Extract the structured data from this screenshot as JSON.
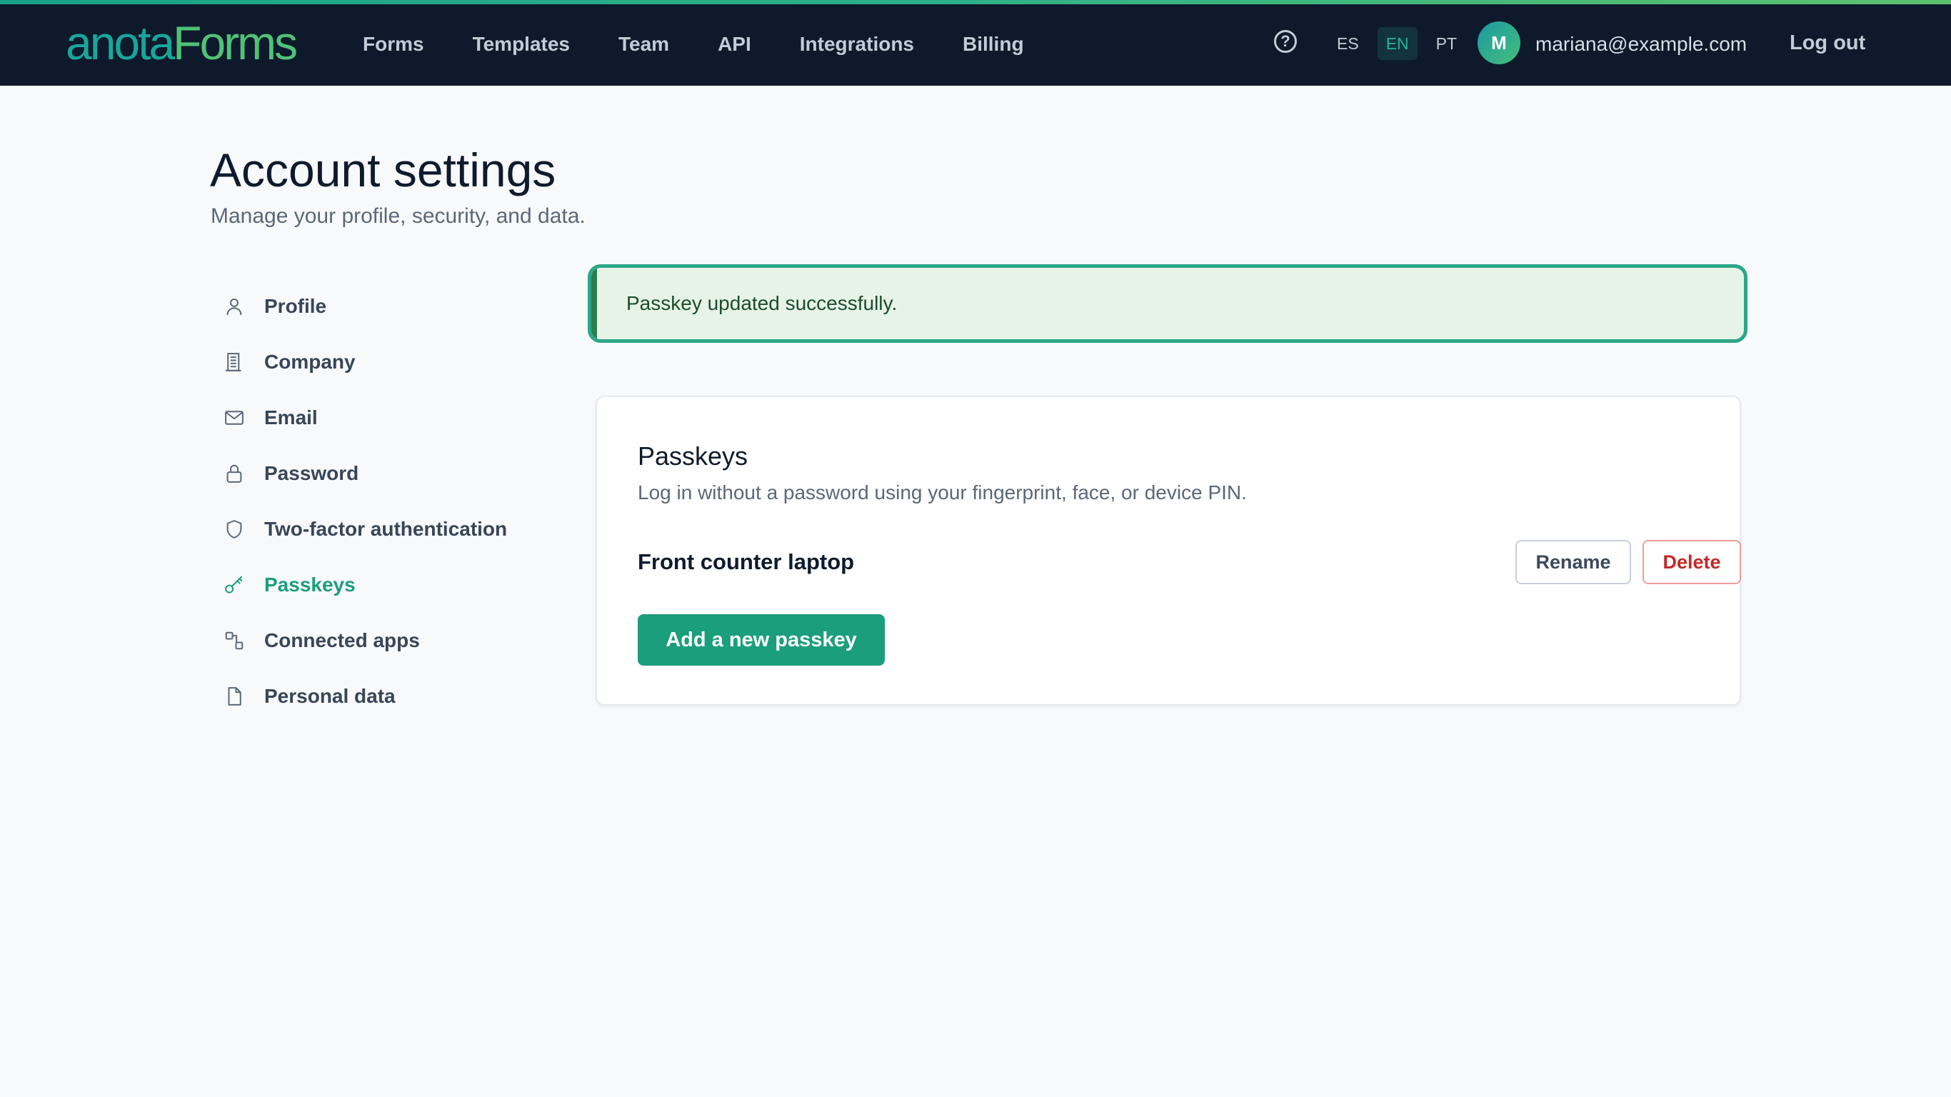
{
  "app": {
    "logo_part1": "anota",
    "logo_part2": "Forms",
    "brand_colors": {
      "teal": "#17a79a",
      "green": "#4fc277",
      "accent": "#1b9e7c"
    }
  },
  "topnav": {
    "items": [
      {
        "label": "Forms"
      },
      {
        "label": "Templates"
      },
      {
        "label": "Team"
      },
      {
        "label": "API"
      },
      {
        "label": "Integrations"
      },
      {
        "label": "Billing"
      }
    ],
    "help_icon": "question-circle-icon",
    "help_glyph": "?",
    "languages": [
      {
        "code": "ES",
        "active": false
      },
      {
        "code": "EN",
        "active": true
      },
      {
        "code": "PT",
        "active": false
      }
    ],
    "user": {
      "initial": "M",
      "email": "mariana@example.com"
    },
    "logout_label": "Log out"
  },
  "page": {
    "title": "Account settings",
    "subtitle": "Manage your profile, security, and data."
  },
  "sidebar": {
    "active": "Passkeys",
    "items": [
      {
        "label": "Profile",
        "icon": "user-icon"
      },
      {
        "label": "Company",
        "icon": "building-icon"
      },
      {
        "label": "Email",
        "icon": "envelope-icon"
      },
      {
        "label": "Password",
        "icon": "lock-icon"
      },
      {
        "label": "Two-factor authentication",
        "icon": "shield-icon"
      },
      {
        "label": "Passkeys",
        "icon": "key-icon"
      },
      {
        "label": "Connected apps",
        "icon": "connected-apps-icon"
      },
      {
        "label": "Personal data",
        "icon": "file-icon"
      }
    ]
  },
  "alert": {
    "message": "Passkey updated successfully.",
    "type": "success",
    "color": "#2aa786"
  },
  "passkeys_card": {
    "title": "Passkeys",
    "description": "Log in without a password using your fingerprint, face, or device PIN.",
    "passkeys": [
      {
        "name": "Front counter laptop",
        "rename_label": "Rename",
        "delete_label": "Delete"
      }
    ],
    "add_label": "Add a new passkey"
  }
}
